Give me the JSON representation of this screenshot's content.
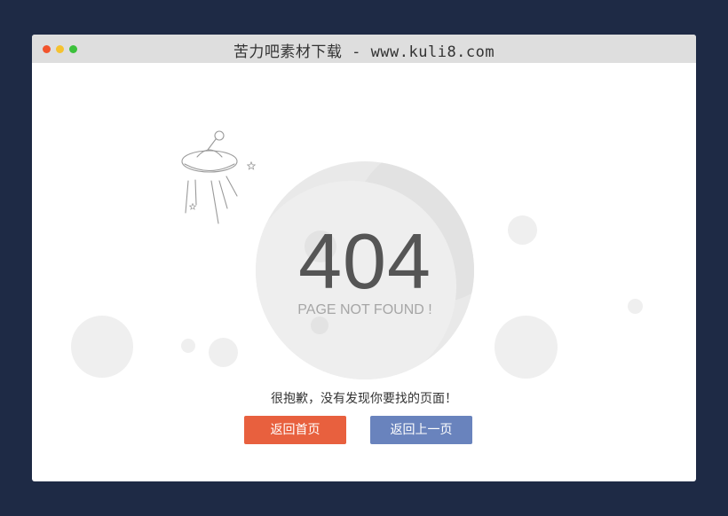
{
  "window": {
    "title": "苦力吧素材下载 - www.kuli8.com"
  },
  "error": {
    "code": "404",
    "subtitle": "PAGE NOT FOUND !",
    "message": "很抱歉，没有发现你要找的页面！"
  },
  "actions": {
    "home_label": "返回首页",
    "back_label": "返回上一页"
  },
  "colors": {
    "page_background": "#1e2a45",
    "home_button": "#e8603e",
    "back_button": "#6983bd"
  },
  "icons": [
    "ufo-icon",
    "star-icon",
    "planet-illustration"
  ]
}
